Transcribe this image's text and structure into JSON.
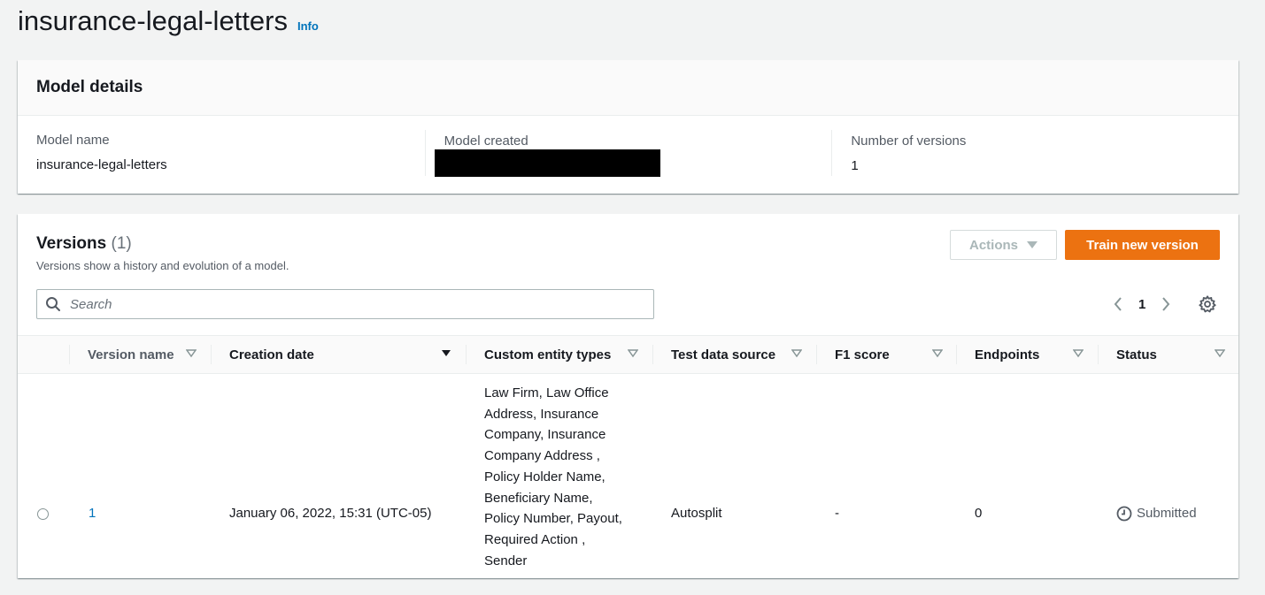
{
  "page": {
    "title": "insurance-legal-letters",
    "info_link": "Info"
  },
  "model_details": {
    "heading": "Model details",
    "model_name_label": "Model name",
    "model_name_value": "insurance-legal-letters",
    "model_created_label": "Model created",
    "versions_label": "Number of versions",
    "versions_value": "1"
  },
  "versions": {
    "heading": "Versions",
    "count": "(1)",
    "description": "Versions show a history and evolution of a model.",
    "actions_label": "Actions",
    "train_label": "Train new version",
    "search_placeholder": "Search",
    "current_page": "1",
    "columns": [
      "Version name",
      "Creation date",
      "Custom entity types",
      "Test data source",
      "F1 score",
      "Endpoints",
      "Status"
    ],
    "rows": [
      {
        "version_name": "1",
        "creation_date": "January 06, 2022, 15:31 (UTC-05)",
        "entity_lines": [
          "Law Firm, Law Office",
          "Address, Insurance",
          "Company, Insurance",
          "Company Address ,",
          "Policy Holder Name,",
          "Beneficiary Name,",
          "Policy Number, Payout,",
          "Required Action ,",
          "Sender"
        ],
        "test_data_source": "Autosplit",
        "f1_score": "-",
        "endpoints": "0",
        "status": "Submitted"
      }
    ]
  },
  "colors": {
    "accent": "#ec7211",
    "link": "#0073bb",
    "background": "#f2f3f3"
  },
  "icons": [
    "search-icon",
    "chevron-left-icon",
    "chevron-right-icon",
    "settings-icon",
    "sort-icon",
    "clock-icon",
    "caret-down-icon"
  ]
}
